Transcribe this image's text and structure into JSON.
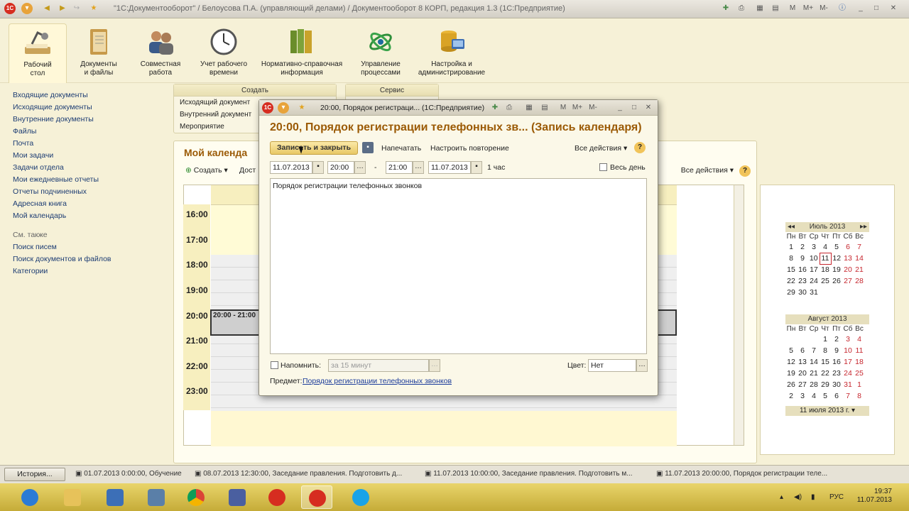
{
  "window": {
    "title": "\"1С:Документооборот\" / Белоусова П.А. (управляющий делами) / Документооборот 8 КОРП, редакция 1.3 (1С:Предприятие)"
  },
  "sections": [
    {
      "label": "Рабочий\nстол",
      "icon": "desk-lamp-icon"
    },
    {
      "label": "Документы\nи файлы",
      "icon": "document-folder-icon"
    },
    {
      "label": "Совместная\nработа",
      "icon": "people-icon"
    },
    {
      "label": "Учет рабочего\nвремени",
      "icon": "clock-icon"
    },
    {
      "label": "Нормативно-справочная\nинформация",
      "icon": "binders-icon"
    },
    {
      "label": "Управление\nпроцессами",
      "icon": "process-icon"
    },
    {
      "label": "Настройка и\nадминистрирование",
      "icon": "database-icon"
    }
  ],
  "sidebar": {
    "items": [
      "Входящие документы",
      "Исходящие документы",
      "Внутренние документы",
      "Файлы",
      "Почта",
      "Мои задачи",
      "Задачи отдела",
      "Мои ежедневные отчеты",
      "Отчеты подчиненных",
      "Адресная книга",
      "Мой календарь"
    ],
    "see_also": "См. также",
    "see_also_items": [
      "Поиск писем",
      "Поиск документов и файлов",
      "Категории"
    ]
  },
  "create_panel": {
    "title": "Создать",
    "items": [
      "Исходящий документ",
      "Внутренний документ",
      "Мероприятие"
    ]
  },
  "service_panel": {
    "title": "Сервис"
  },
  "calendar": {
    "title": "Мой календа",
    "create": "Создать",
    "available": "Дост",
    "all_actions": "Все действия",
    "hours": [
      "16:00",
      "17:00",
      "18:00",
      "19:00",
      "20:00",
      "21:00",
      "22:00",
      "23:00"
    ],
    "event_label": "20:00 - 21:00"
  },
  "mini_july": {
    "header": "Июль 2013",
    "days": [
      "Пн",
      "Вт",
      "Ср",
      "Чт",
      "Пт",
      "Сб",
      "Вс"
    ],
    "weeks": [
      [
        "1",
        "2",
        "3",
        "4",
        "5",
        "6",
        "7"
      ],
      [
        "8",
        "9",
        "10",
        "11",
        "12",
        "13",
        "14"
      ],
      [
        "15",
        "16",
        "17",
        "18",
        "19",
        "20",
        "21"
      ],
      [
        "22",
        "23",
        "24",
        "25",
        "26",
        "27",
        "28"
      ],
      [
        "29",
        "30",
        "31",
        "",
        "",
        "",
        ""
      ]
    ]
  },
  "mini_august": {
    "header": "Август 2013",
    "days": [
      "Пн",
      "Вт",
      "Ср",
      "Чт",
      "Пт",
      "Сб",
      "Вс"
    ],
    "weeks": [
      [
        "",
        "",
        "",
        "1",
        "2",
        "3",
        "4"
      ],
      [
        "5",
        "6",
        "7",
        "8",
        "9",
        "10",
        "11"
      ],
      [
        "12",
        "13",
        "14",
        "15",
        "16",
        "17",
        "18"
      ],
      [
        "19",
        "20",
        "21",
        "22",
        "23",
        "24",
        "25"
      ],
      [
        "26",
        "27",
        "28",
        "29",
        "30",
        "31",
        "1"
      ],
      [
        "2",
        "3",
        "4",
        "5",
        "6",
        "7",
        "8"
      ]
    ]
  },
  "selected_date": "11 июля 2013 г.",
  "dialog": {
    "window_title": "20:00, Порядок регистраци... (1С:Предприятие)",
    "heading": "20:00, Порядок регистрации телефонных зв... (Запись календаря)",
    "save_close": "Записать и закрыть",
    "print": "Напечатать",
    "repeat": "Настроить повторение",
    "all_actions": "Все действия",
    "date_start": "11.07.2013",
    "time_start": "20:00",
    "dash": "-",
    "time_end": "21:00",
    "date_end": "11.07.2013",
    "duration": "1 час",
    "all_day": "Весь день",
    "description": "Порядок регистрации телефонных звонков",
    "remind": "Напомнить:",
    "remind_value": "за 15 минут",
    "color_label": "Цвет:",
    "color_value": "Нет",
    "subject_label": "Предмет:",
    "subject_link": "Порядок регистрации телефонных звонков"
  },
  "history": {
    "button": "История...",
    "items": [
      "01.07.2013 0:00:00, Обучение",
      "08.07.2013 12:30:00, Заседание правления. Подготовить д...",
      "11.07.2013 10:00:00, Заседание правления. Подготовить м...",
      "11.07.2013 20:00:00, Порядок регистрации теле..."
    ]
  },
  "taskbar": {
    "apps": [
      "ie-icon",
      "explorer-icon",
      "control-panel-icon",
      "remote-desktop-icon",
      "chrome-icon",
      "network-icon",
      "1c-icon",
      "1c-active-icon",
      "skype-icon"
    ],
    "lang": "РУС",
    "time": "19:37",
    "date": "11.07.2013"
  }
}
